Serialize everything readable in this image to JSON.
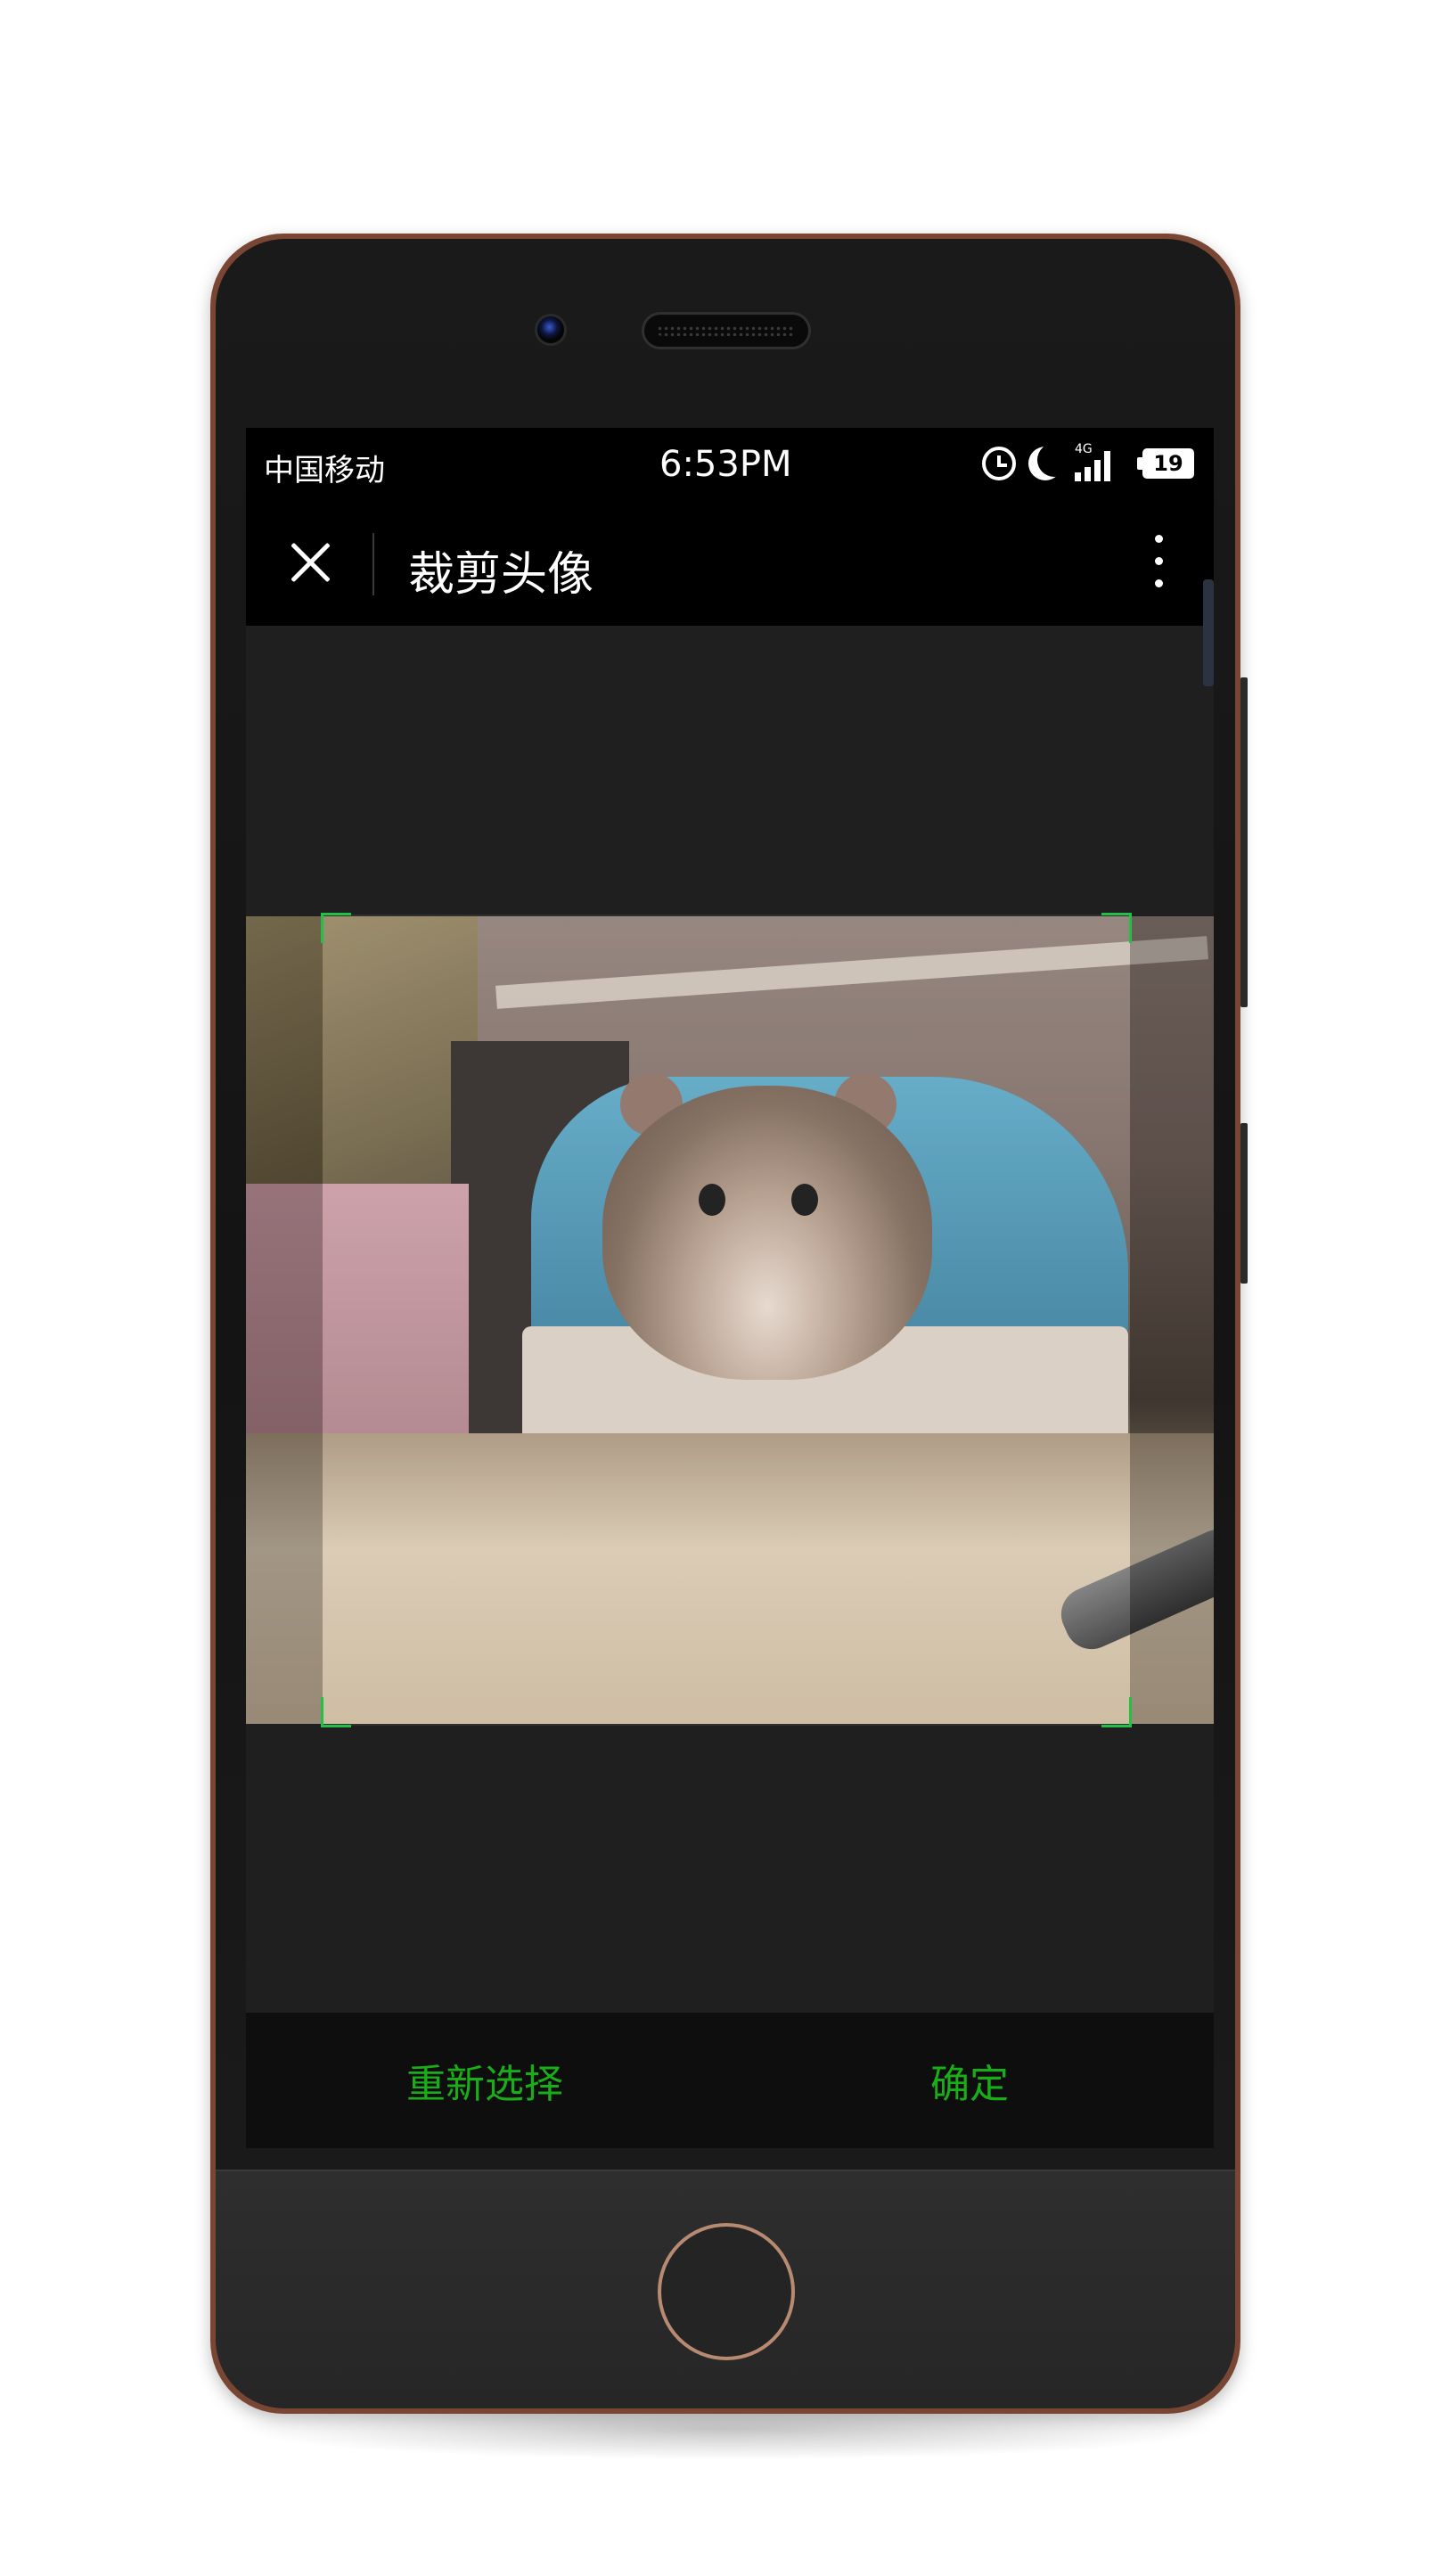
{
  "status_bar": {
    "carrier": "中国移动",
    "time": "6:53PM",
    "network": "4G",
    "battery": "19"
  },
  "app_bar": {
    "title": "裁剪头像"
  },
  "crop": {
    "accent_color": "#22c047"
  },
  "bottom_bar": {
    "reselect_label": "重新选择",
    "confirm_label": "确定",
    "action_color": "#1aad19"
  },
  "icons": [
    "alarm-icon",
    "moon-icon",
    "signal-icon",
    "battery-icon",
    "close-icon",
    "more-vertical-icon"
  ]
}
